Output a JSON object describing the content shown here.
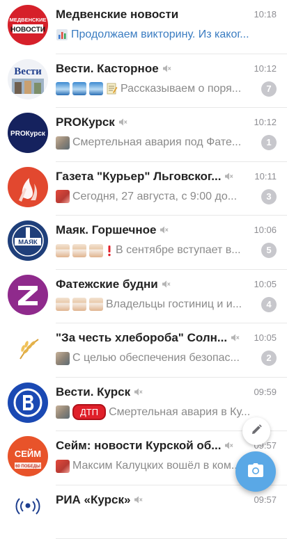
{
  "chats": [
    {
      "name": "Медвенские новости",
      "time": "10:18",
      "preview": "Продолжаем викторину. Из каког...",
      "muted": false,
      "unread": ""
    },
    {
      "name": "Вести. Касторное",
      "time": "10:12",
      "preview": "Рассказываем о поря...",
      "muted": true,
      "unread": "7"
    },
    {
      "name": "PROКурск",
      "time": "10:12",
      "preview": "Смертельная авария под Фате...",
      "muted": true,
      "unread": "1"
    },
    {
      "name": "Газета \"Курьер\" Льговског...",
      "time": "10:11",
      "preview": "Сегодня, 27 августа, с 9:00 до...",
      "muted": true,
      "unread": "3"
    },
    {
      "name": "Маяк. Горшечное",
      "time": "10:06",
      "preview": "В сентябре вступает в...",
      "muted": true,
      "unread": "5"
    },
    {
      "name": "Фатежские будни",
      "time": "10:05",
      "preview": "Владельцы гостиниц и и...",
      "muted": true,
      "unread": "4"
    },
    {
      "name": "\"За честь хлебороба\" Солн...",
      "time": "10:05",
      "preview": "С целью обеспечения безопас...",
      "muted": true,
      "unread": "2"
    },
    {
      "name": "Вести. Курск",
      "time": "09:59",
      "preview": "Смертельная авария в Ку...",
      "tag": "ДТП",
      "muted": true,
      "unread": ""
    },
    {
      "name": "Сейм: новости Курской об...",
      "time": "09:57",
      "preview": "Максим Калуцких вошёл в ком...",
      "muted": true,
      "unread": ""
    },
    {
      "name": "РИА «Курск»",
      "time": "09:57",
      "preview": "",
      "muted": true,
      "unread": ""
    }
  ],
  "avatars": {
    "medvenskie": {
      "line1": "МЕДВЕНСКИЕ",
      "line2": "НОВОСТИ"
    },
    "vesti_kastornoe": {
      "label": "Вести"
    },
    "prokursk": {
      "label": "PROКурск"
    },
    "mayak": {
      "label": "МАЯК"
    },
    "seym": {
      "label": "СЕЙМ",
      "sub": "60 ПОБЕДЫ"
    }
  },
  "colors": {
    "accent_text": "#3a7cc1",
    "badge": "#c7c7cc",
    "camera_fab": "#5aa8e6",
    "tag": "#e0202a"
  },
  "icons": {
    "edit": "pencil-icon",
    "camera": "camera-icon",
    "mute": "muted-speaker-icon"
  }
}
